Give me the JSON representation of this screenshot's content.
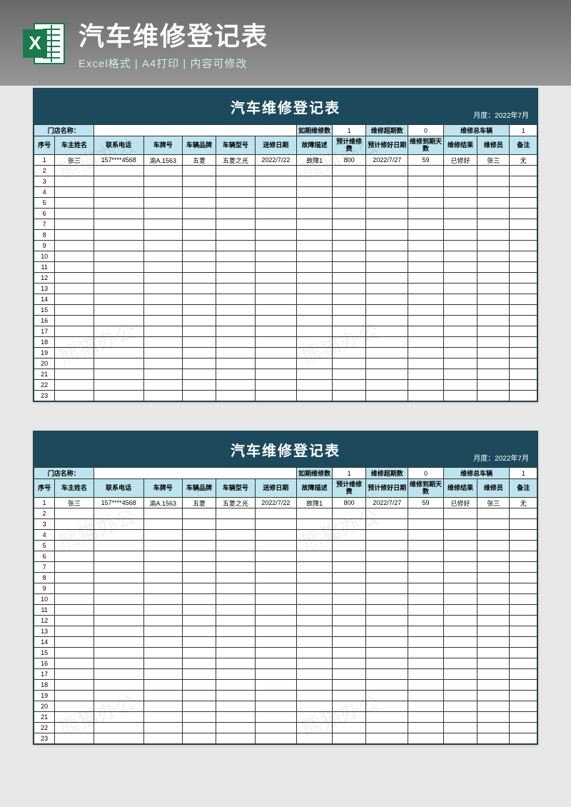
{
  "header": {
    "title": "汽车维修登记表",
    "subtitle": "Excel格式 | A4打印 | 内容可修改",
    "icon_label": "X"
  },
  "sheet": {
    "title": "汽车维修登记表",
    "month_label": "月度：",
    "month_value": "2022年7月",
    "stats": {
      "store_label": "门店名称：",
      "on_time_label": "如期维修数",
      "on_time_value": "1",
      "overdue_label": "维修超期数",
      "overdue_value": "0",
      "total_label": "维修总车辆",
      "total_value": "1"
    },
    "columns": [
      "序号",
      "车主姓名",
      "联系电话",
      "车牌号",
      "车辆品牌",
      "车辆型号",
      "送修日期",
      "故障描述",
      "预计维修费",
      "预计修好日期",
      "维修到期天数",
      "维修结果",
      "维修员",
      "备注"
    ],
    "row1": [
      "1",
      "张三",
      "157****4568",
      "渝A.1563",
      "五菱",
      "五菱之光",
      "2022/7/22",
      "故障1",
      "800",
      "2022/7/27",
      "59",
      "已修好",
      "张三",
      "无"
    ],
    "empty_rows": [
      "2",
      "3",
      "4",
      "5",
      "6",
      "7",
      "8",
      "9",
      "10",
      "11",
      "12",
      "13",
      "14",
      "15",
      "16",
      "17",
      "18",
      "19",
      "20",
      "21",
      "22",
      "23"
    ]
  },
  "watermark": "熊猫办公"
}
